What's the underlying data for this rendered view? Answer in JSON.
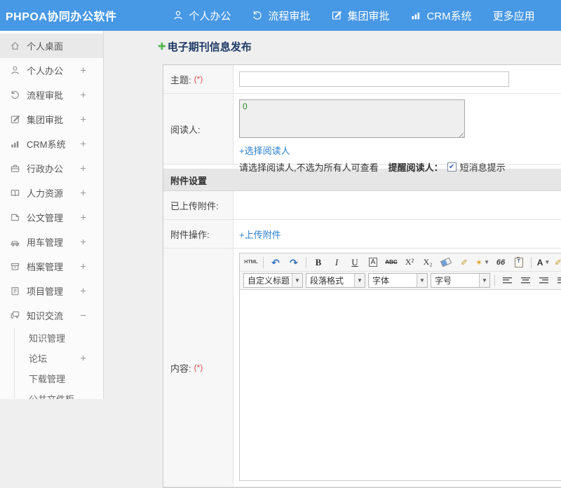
{
  "header": {
    "logo": "PHPOA协同办公软件",
    "nav": [
      {
        "name": "nav-personal-office",
        "icon": "user",
        "label": "个人办公"
      },
      {
        "name": "nav-process-approval",
        "icon": "process",
        "label": "流程审批"
      },
      {
        "name": "nav-group-approval",
        "icon": "edit",
        "label": "集团审批"
      },
      {
        "name": "nav-crm-system",
        "icon": "chart",
        "label": "CRM系统"
      },
      {
        "name": "nav-more-apps",
        "icon": "",
        "label": "更多应用",
        "caret": true
      }
    ]
  },
  "sidebar": {
    "items": [
      {
        "name": "sidebar-item-personal-desktop",
        "icon": "home",
        "label": "个人桌面",
        "active": true
      },
      {
        "name": "sidebar-item-personal-office",
        "icon": "user",
        "label": "个人办公",
        "expand": "+"
      },
      {
        "name": "sidebar-item-process-approval",
        "icon": "process",
        "label": "流程审批",
        "expand": "+"
      },
      {
        "name": "sidebar-item-group-approval",
        "icon": "edit",
        "label": "集团审批",
        "expand": "+"
      },
      {
        "name": "sidebar-item-crm",
        "icon": "chart",
        "label": "CRM系统",
        "expand": "+"
      },
      {
        "name": "sidebar-item-admin-office",
        "icon": "briefcase",
        "label": "行政办公",
        "expand": "+"
      },
      {
        "name": "sidebar-item-hr",
        "icon": "book",
        "label": "人力资源",
        "expand": "+"
      },
      {
        "name": "sidebar-item-document-mgmt",
        "icon": "doc",
        "label": "公文管理",
        "expand": "+"
      },
      {
        "name": "sidebar-item-vehicle-mgmt",
        "icon": "car",
        "label": "用车管理",
        "expand": "+"
      },
      {
        "name": "sidebar-item-archive-mgmt",
        "icon": "archive",
        "label": "档案管理",
        "expand": "+"
      },
      {
        "name": "sidebar-item-project-mgmt",
        "icon": "project",
        "label": "项目管理",
        "expand": "+"
      },
      {
        "name": "sidebar-item-knowledge-exchange",
        "icon": "chat",
        "label": "知识交流",
        "expand": "−",
        "children": [
          {
            "name": "sidebar-subitem-knowledge-mgmt",
            "label": "知识管理"
          },
          {
            "name": "sidebar-subitem-forum",
            "label": "论坛",
            "expand": "+"
          },
          {
            "name": "sidebar-subitem-download-mgmt",
            "label": "下载管理"
          },
          {
            "name": "sidebar-subitem-public-file-cabinet",
            "label": "公共文件柜"
          }
        ]
      }
    ]
  },
  "main": {
    "page_title": "电子期刊信息发布",
    "form": {
      "subject_label": "主题:",
      "required_mark": "(*)",
      "subject_value": "",
      "readers_label": "阅读人:",
      "readers_value": "0",
      "select_readers_link": "+选择阅读人",
      "readers_note": "请选择阅读人,不选为所有人可查看",
      "remind_readers_label": "提醒阅读人：",
      "sms_notice_label": "短消息提示",
      "sms_checked": true,
      "attachment_section_title": "附件设置",
      "uploaded_attachment_label": "已上传附件:",
      "attachment_action_label": "附件操作:",
      "upload_attachment_link": "+上传附件",
      "content_label": "内容:"
    },
    "editor": {
      "toolbar_row1": [
        {
          "name": "source-code-button",
          "type": "text",
          "label": "HTML",
          "cls": "t-html"
        },
        {
          "type": "sep"
        },
        {
          "name": "undo-button",
          "type": "icon",
          "icon": "undo"
        },
        {
          "name": "redo-button",
          "type": "icon",
          "icon": "redo"
        },
        {
          "type": "sep"
        },
        {
          "name": "bold-button",
          "type": "text",
          "label": "B",
          "cls": "t-bold"
        },
        {
          "name": "italic-button",
          "type": "text",
          "label": "I",
          "cls": "t-italic"
        },
        {
          "name": "underline-button",
          "type": "text",
          "label": "U",
          "cls": "t-under"
        },
        {
          "name": "font-box-button",
          "type": "text",
          "label": "A",
          "cls": "t-boxa"
        },
        {
          "name": "strikethrough-button",
          "type": "text",
          "label": "ABC",
          "cls": "t-strike"
        },
        {
          "name": "superscript-button",
          "type": "text",
          "label": "X²",
          "cls": "t-sup"
        },
        {
          "name": "subscript-button",
          "type": "text",
          "label": "X₂",
          "cls": "t-sub"
        },
        {
          "name": "remove-format-button",
          "type": "icon",
          "icon": "eraser"
        },
        {
          "name": "format-brush-button",
          "type": "icon",
          "icon": "hilite"
        },
        {
          "name": "quick-format-button",
          "type": "icon",
          "icon": "wand",
          "caret": true
        },
        {
          "name": "blockquote-button",
          "type": "text",
          "label": "66",
          "cls": "t-quote"
        },
        {
          "name": "paste-button",
          "type": "icon",
          "icon": "paste"
        },
        {
          "type": "sep"
        },
        {
          "name": "font-color-button",
          "type": "text",
          "label": "A",
          "cls": "t-fore",
          "caret": true
        },
        {
          "name": "highlight-color-button",
          "type": "icon",
          "icon": "hilite",
          "caret": true
        },
        {
          "name": "ordered-list-button",
          "type": "icon",
          "icon": "ol",
          "caret": true
        },
        {
          "name": "unordered-list-button",
          "type": "icon",
          "icon": "ul"
        }
      ],
      "toolbar_row2": [
        {
          "name": "custom-heading-select",
          "type": "select",
          "label": "自定义标题"
        },
        {
          "name": "paragraph-format-select",
          "type": "select",
          "label": "段落格式"
        },
        {
          "name": "font-family-select",
          "type": "select",
          "label": "字体"
        },
        {
          "name": "font-size-select",
          "type": "select",
          "label": "字号"
        },
        {
          "type": "sep"
        },
        {
          "name": "align-left-button",
          "type": "icon",
          "icon": "align-left"
        },
        {
          "name": "align-center-button",
          "type": "icon",
          "icon": "align-center"
        },
        {
          "name": "align-right-button",
          "type": "icon",
          "icon": "align-right"
        },
        {
          "name": "align-justify-button",
          "type": "icon",
          "icon": "align-justify"
        },
        {
          "name": "insert-link-button",
          "type": "icon",
          "icon": "link"
        },
        {
          "name": "remove-link-button",
          "type": "icon",
          "icon": "unlink"
        },
        {
          "name": "insert-image-button",
          "type": "icon",
          "icon": "image"
        },
        {
          "name": "image-manager-button",
          "type": "icon",
          "icon": "images"
        }
      ]
    }
  },
  "colors": {
    "header_bg": "#4798e5",
    "link_blue": "#2a80d0",
    "title_navy": "#1e3a66",
    "required_red": "#e05050",
    "readers_value_green": "#2f8a2f"
  }
}
